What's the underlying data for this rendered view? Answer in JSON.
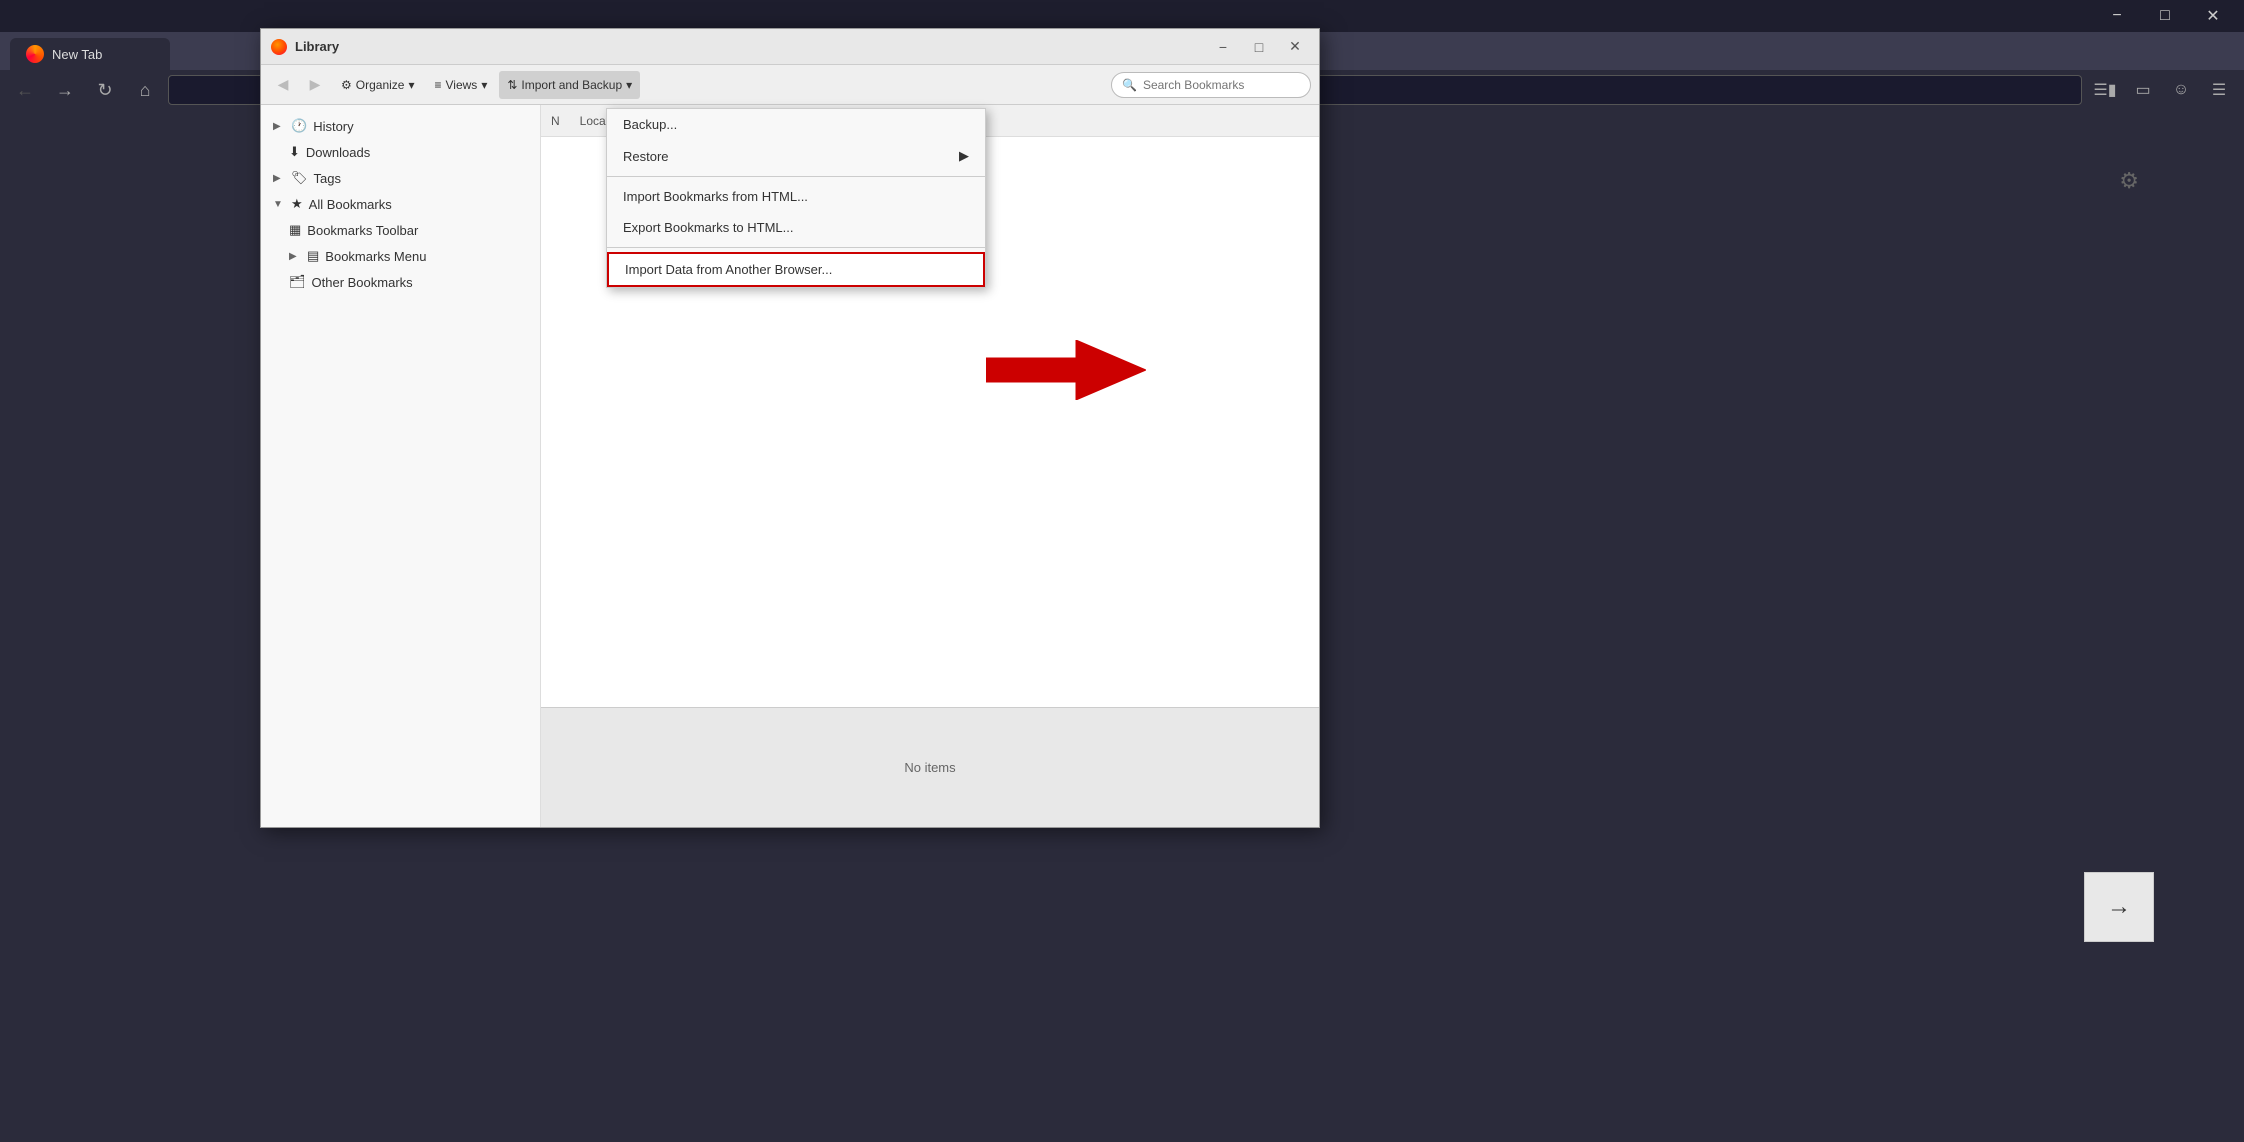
{
  "browser": {
    "tab_label": "New Tab",
    "window_controls": {
      "minimize": "−",
      "maximize": "□",
      "close": "✕"
    }
  },
  "library_dialog": {
    "title": "Library",
    "window_controls": {
      "minimize": "−",
      "maximize": "□",
      "close": "✕"
    },
    "toolbar": {
      "back_label": "◀",
      "forward_label": "▶",
      "organize_label": "Organize",
      "organize_arrow": "▾",
      "views_icon": "≡",
      "views_label": "Views",
      "views_arrow": "▾",
      "import_icon": "⇅",
      "import_label": "Import and Backup",
      "import_arrow": "▾",
      "search_placeholder": "Search Bookmarks"
    },
    "sidebar": {
      "items": [
        {
          "id": "history",
          "label": "History",
          "icon": "🕐",
          "expandable": true,
          "expanded": false,
          "indent": 0
        },
        {
          "id": "downloads",
          "label": "Downloads",
          "icon": "⬇",
          "expandable": false,
          "indent": 1
        },
        {
          "id": "tags",
          "label": "Tags",
          "icon": "🏷",
          "expandable": true,
          "expanded": false,
          "indent": 0
        },
        {
          "id": "all-bookmarks",
          "label": "All Bookmarks",
          "icon": "★",
          "expandable": true,
          "expanded": true,
          "indent": 0
        },
        {
          "id": "bookmarks-toolbar",
          "label": "Bookmarks Toolbar",
          "icon": "▦",
          "expandable": false,
          "indent": 1
        },
        {
          "id": "bookmarks-menu",
          "label": "Bookmarks Menu",
          "icon": "▤",
          "expandable": true,
          "expanded": false,
          "indent": 1
        },
        {
          "id": "other-bookmarks",
          "label": "Other Bookmarks",
          "icon": "🗂",
          "expandable": false,
          "indent": 1
        }
      ]
    },
    "content_header": {
      "name_col": "N",
      "location_col": "Location"
    },
    "no_items_label": "No items"
  },
  "import_menu": {
    "items": [
      {
        "id": "backup",
        "label": "Backup...",
        "has_arrow": false
      },
      {
        "id": "restore",
        "label": "Restore",
        "has_arrow": true
      },
      {
        "id": "sep1",
        "type": "separator"
      },
      {
        "id": "import-html",
        "label": "Import Bookmarks from HTML...",
        "has_arrow": false
      },
      {
        "id": "export-html",
        "label": "Export Bookmarks to HTML...",
        "has_arrow": false
      },
      {
        "id": "sep2",
        "type": "separator"
      },
      {
        "id": "import-browser",
        "label": "Import Data from Another Browser...",
        "has_arrow": false,
        "highlighted": true
      }
    ]
  },
  "annotation": {
    "arrow_direction": "left",
    "color": "#cc0000"
  }
}
